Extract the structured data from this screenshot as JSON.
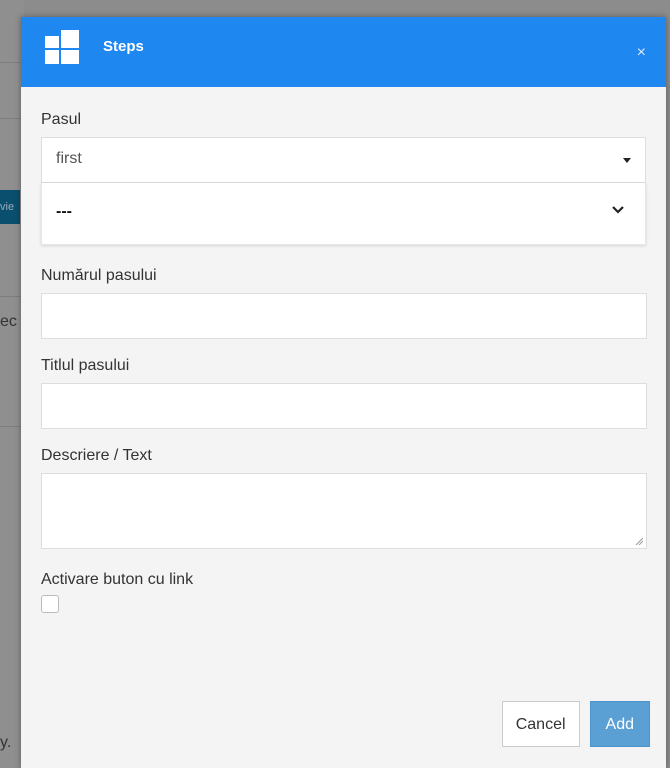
{
  "background": {
    "fragments": [
      "vie",
      "ec",
      "y."
    ]
  },
  "modal": {
    "title": "Steps",
    "close_icon": "×"
  },
  "form": {
    "step_label": "Pasul",
    "step_selected": "first",
    "step_secondary_selected": "---",
    "step_number_label": "Numărul pasului",
    "step_title_label": "Titlul pasului",
    "description_label": "Descriere / Text",
    "enable_link_button_label": "Activare buton cu link"
  },
  "footer": {
    "cancel_label": "Cancel",
    "add_label": "Add"
  },
  "colors": {
    "header": "#1f87f0",
    "add_button": "#5aa0d4"
  },
  "icons": {
    "logo": "grid-logo-icon",
    "close": "close-icon",
    "select_caret": "caret-down-icon",
    "dropdown_chevron": "chevron-down-icon",
    "resize": "resize-grip-icon"
  }
}
